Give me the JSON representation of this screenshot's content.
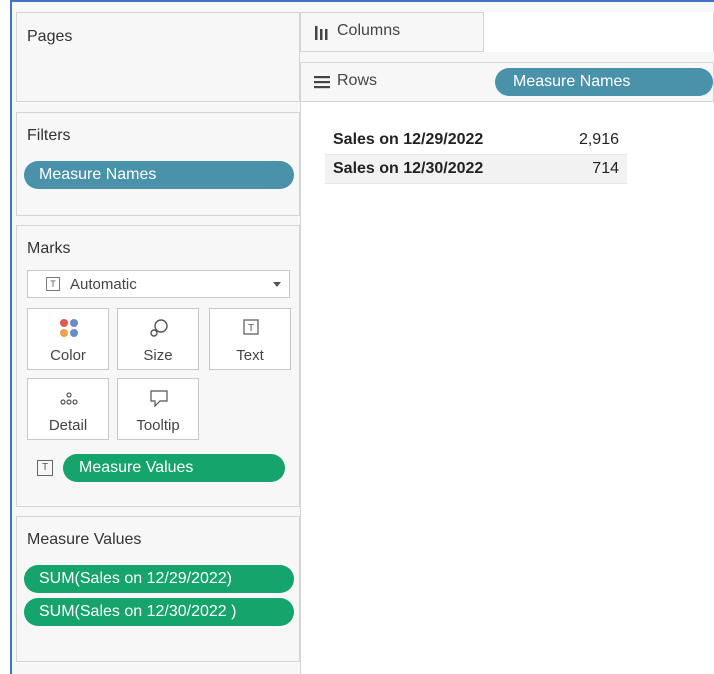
{
  "pages": {
    "title": "Pages"
  },
  "filters": {
    "title": "Filters",
    "pill": "Measure Names"
  },
  "marks": {
    "title": "Marks",
    "mark_type": "Automatic",
    "buttons": {
      "color": "Color",
      "size": "Size",
      "text": "Text",
      "detail": "Detail",
      "tooltip": "Tooltip"
    },
    "text_pill": "Measure Values"
  },
  "measure_values": {
    "title": "Measure Values",
    "pills": [
      "SUM(Sales on 12/29/2022)",
      "SUM(Sales on 12/30/2022 )"
    ]
  },
  "shelves": {
    "columns_label": "Columns",
    "rows_label": "Rows",
    "rows_pill": "Measure Names"
  },
  "view": {
    "rows": [
      {
        "header": "Sales on 12/29/2022",
        "value": "2,916"
      },
      {
        "header": "Sales on 12/30/2022",
        "value": "714"
      }
    ]
  },
  "colors": {
    "dimension_pill": "#4a92aa",
    "measure_pill": "#14a46c",
    "frame": "#4472c4"
  }
}
